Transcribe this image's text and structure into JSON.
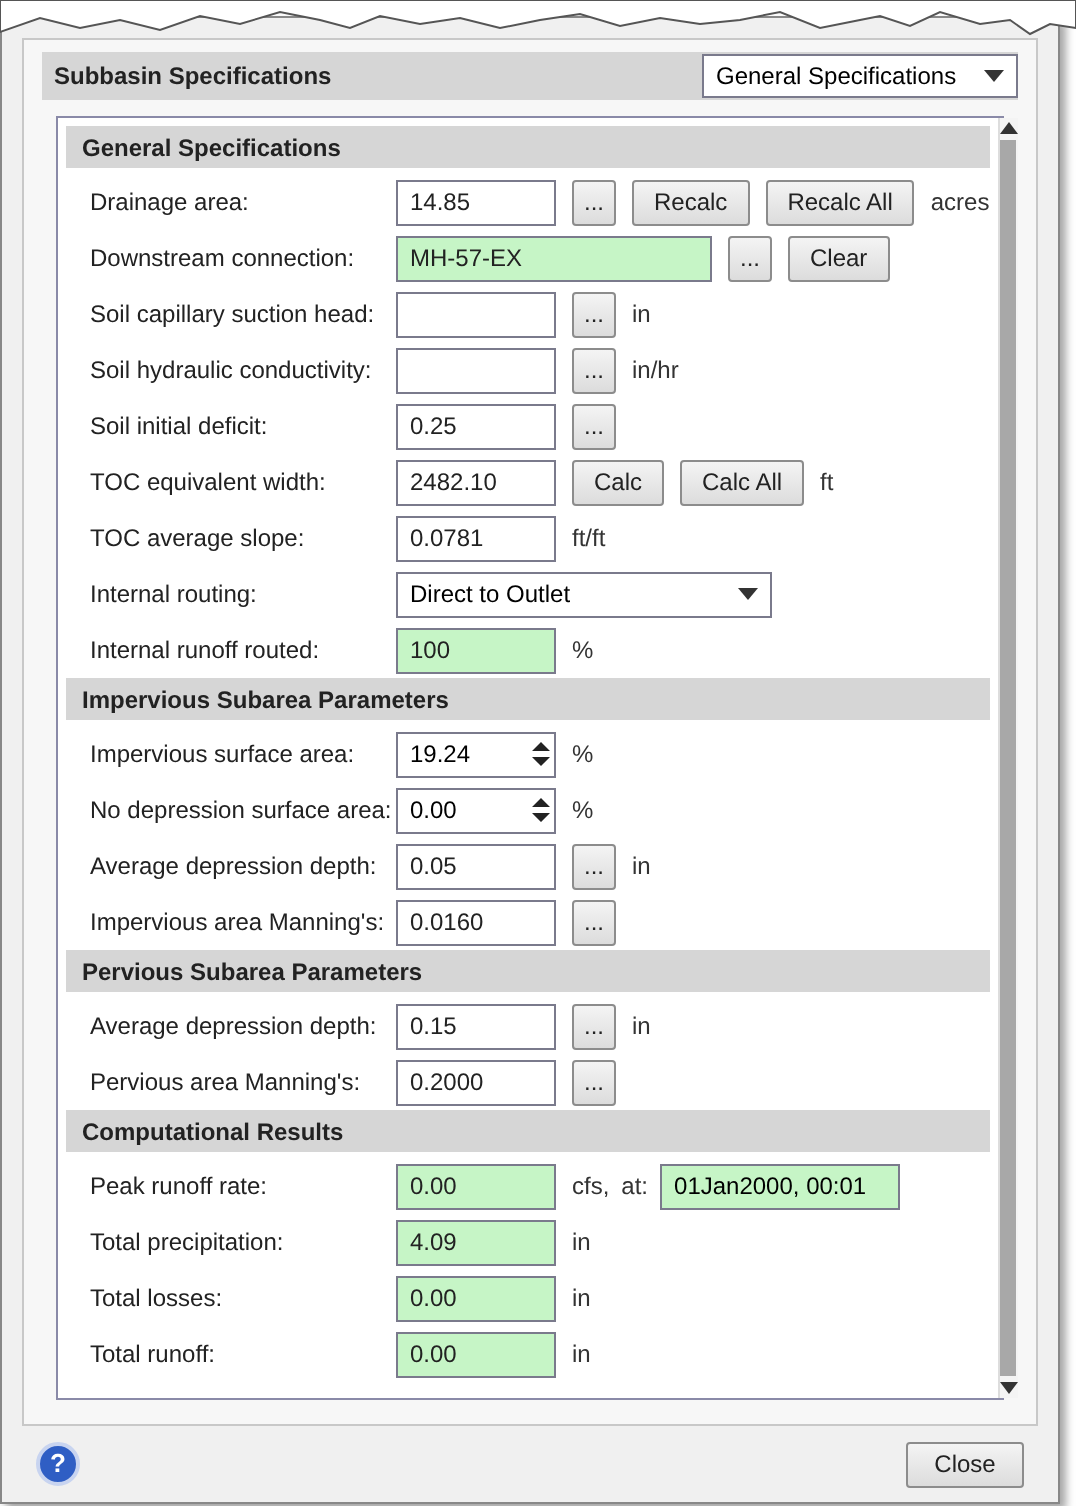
{
  "header": {
    "title": "Subbasin Specifications",
    "view_select": "General Specifications"
  },
  "sections": [
    {
      "title": "General Specifications",
      "rows": [
        {
          "label": "Drainage area:",
          "kind": "text",
          "value": "14.85",
          "highlighted": false,
          "buttons": [
            {
              "label": "...",
              "kind": "browse"
            },
            {
              "label": "Recalc",
              "kind": "action"
            },
            {
              "label": "Recalc All",
              "kind": "action"
            }
          ],
          "unit": "acres"
        },
        {
          "label": "Downstream connection:",
          "kind": "wide",
          "value": "MH-57-EX",
          "highlighted": true,
          "buttons": [
            {
              "label": "...",
              "kind": "browse"
            },
            {
              "label": "Clear",
              "kind": "action"
            }
          ]
        },
        {
          "label": "Soil capillary suction head:",
          "kind": "text",
          "highlighted": false,
          "buttons": [
            {
              "label": "...",
              "kind": "browse"
            }
          ],
          "unit": "in"
        },
        {
          "label": "Soil hydraulic conductivity:",
          "kind": "text",
          "highlighted": false,
          "buttons": [
            {
              "label": "...",
              "kind": "browse"
            }
          ],
          "unit": "in/hr"
        },
        {
          "label": "Soil initial deficit:",
          "kind": "text",
          "value": "0.25",
          "highlighted": false,
          "buttons": [
            {
              "label": "...",
              "kind": "browse"
            }
          ]
        },
        {
          "label": "TOC equivalent width:",
          "kind": "text",
          "value": "2482.10",
          "highlighted": false,
          "buttons": [
            {
              "label": "Calc",
              "kind": "action"
            },
            {
              "label": "Calc All",
              "kind": "action"
            }
          ],
          "unit": "ft"
        },
        {
          "label": "TOC average slope:",
          "kind": "text",
          "value": "0.0781",
          "highlighted": false,
          "unit": "ft/ft"
        },
        {
          "label": "Internal routing:",
          "kind": "select",
          "value": "Direct to Outlet"
        },
        {
          "label": "Internal runoff routed:",
          "kind": "text",
          "value": "100",
          "highlighted": true,
          "unit": "%"
        }
      ]
    },
    {
      "title": "Impervious Subarea Parameters",
      "rows": [
        {
          "label": "Impervious surface area:",
          "kind": "spinner",
          "value": "19.24",
          "unit": "%"
        },
        {
          "label": "No depression surface area:",
          "kind": "spinner",
          "value": "0.00",
          "unit": "%"
        },
        {
          "label": "Average depression depth:",
          "kind": "text",
          "value": "0.05",
          "highlighted": false,
          "buttons": [
            {
              "label": "...",
              "kind": "browse"
            }
          ],
          "unit": "in"
        },
        {
          "label": "Impervious area Manning's:",
          "kind": "text",
          "value": "0.0160",
          "highlighted": false,
          "buttons": [
            {
              "label": "...",
              "kind": "browse"
            }
          ]
        }
      ]
    },
    {
      "title": "Pervious Subarea Parameters",
      "rows": [
        {
          "label": "Average depression depth:",
          "kind": "text",
          "value": "0.15",
          "highlighted": false,
          "buttons": [
            {
              "label": "...",
              "kind": "browse"
            }
          ],
          "unit": "in"
        },
        {
          "label": "Pervious area Manning's:",
          "kind": "text",
          "value": "0.2000",
          "highlighted": false,
          "buttons": [
            {
              "label": "...",
              "kind": "browse"
            }
          ]
        }
      ]
    },
    {
      "title": "Computational Results",
      "rows": [
        {
          "label": "Peak runoff rate:",
          "kind": "text",
          "value": "0.00",
          "highlighted": true,
          "unit": "cfs,",
          "extra": {
            "label": "at:",
            "value": "01Jan2000, 00:01",
            "highlighted": true
          }
        },
        {
          "label": "Total precipitation:",
          "kind": "text",
          "value": "4.09",
          "highlighted": true,
          "unit": "in"
        },
        {
          "label": "Total losses:",
          "kind": "text",
          "value": "0.00",
          "highlighted": true,
          "unit": "in"
        },
        {
          "label": "Total runoff:",
          "kind": "text",
          "value": "0.00",
          "highlighted": true,
          "unit": "in"
        }
      ]
    }
  ],
  "footer": {
    "help": "?",
    "close": "Close"
  }
}
